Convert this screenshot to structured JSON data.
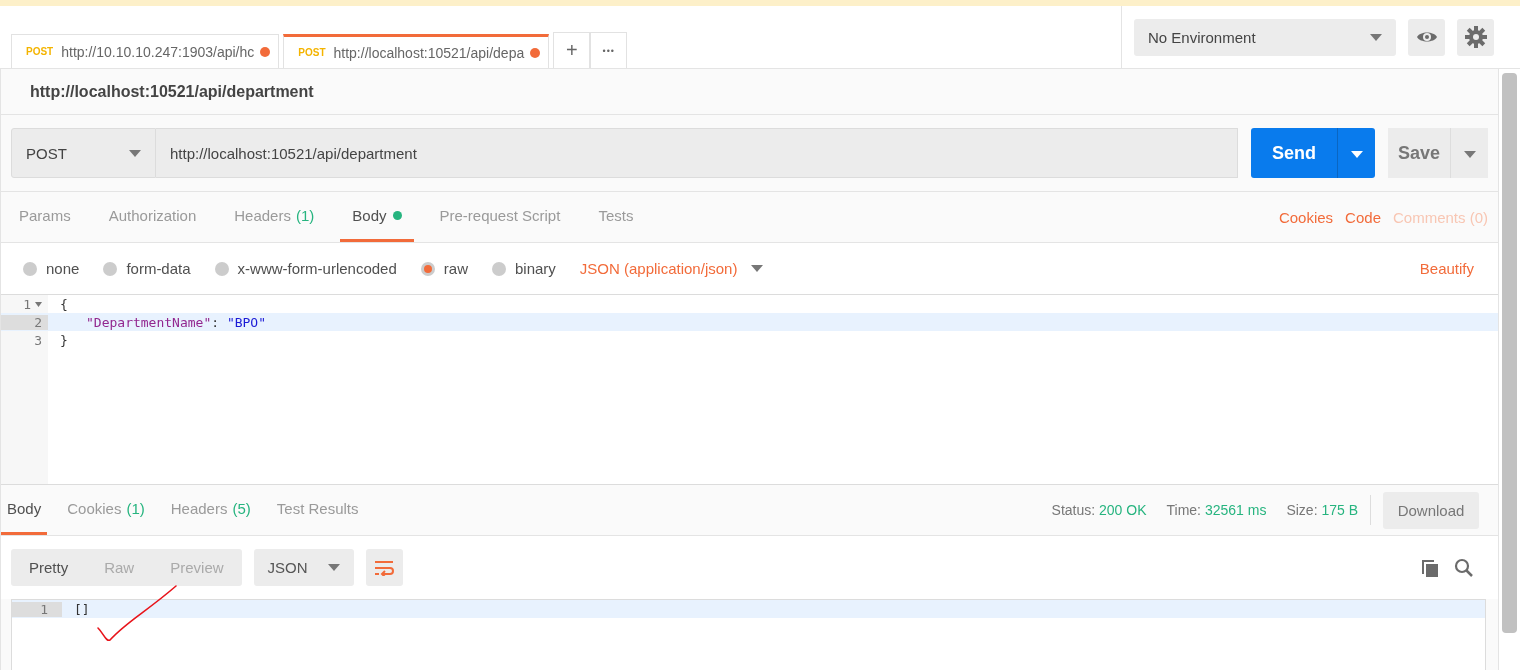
{
  "tabs": [
    {
      "method": "POST",
      "url": "http://10.10.10.247:1903/api/hc",
      "unsaved": true,
      "selected": false
    },
    {
      "method": "POST",
      "url": "http://localhost:10521/api/depa",
      "unsaved": true,
      "selected": true
    }
  ],
  "new_tab": "+",
  "more_tabs": "•••",
  "environment": {
    "label": "No Environment"
  },
  "request": {
    "title": "http://localhost:10521/api/department",
    "method": "POST",
    "url": "http://localhost:10521/api/department",
    "send": "Send",
    "save": "Save"
  },
  "request_tabs": [
    {
      "label": "Params",
      "selected": false,
      "has_data": false
    },
    {
      "label": "Authorization",
      "selected": false,
      "has_data": false
    },
    {
      "label": "Headers",
      "count": "(1)",
      "selected": false,
      "has_data": false
    },
    {
      "label": "Body",
      "selected": true,
      "has_data": true
    },
    {
      "label": "Pre-request Script",
      "selected": false,
      "has_data": false
    },
    {
      "label": "Tests",
      "selected": false,
      "has_data": false
    }
  ],
  "request_links": [
    {
      "label": "Cookies",
      "disabled": false
    },
    {
      "label": "Code",
      "disabled": false
    },
    {
      "label": "Comments (0)",
      "disabled": true
    }
  ],
  "body_modes": [
    {
      "label": "none",
      "selected": false
    },
    {
      "label": "form-data",
      "selected": false
    },
    {
      "label": "x-www-form-urlencoded",
      "selected": false
    },
    {
      "label": "raw",
      "selected": true
    },
    {
      "label": "binary",
      "selected": false
    }
  ],
  "body_format": "JSON (application/json)",
  "beautify": "Beautify",
  "request_lines": [
    {
      "number": "1",
      "foldable": true,
      "highlighted": false,
      "tokens": [
        {
          "kind": "punct",
          "text": "{"
        }
      ]
    },
    {
      "number": "2",
      "foldable": false,
      "highlighted": true,
      "tokens": [
        {
          "kind": "key",
          "text": "\"DepartmentName\""
        },
        {
          "kind": "punct",
          "text": ": "
        },
        {
          "kind": "string",
          "text": "\"BPO\""
        }
      ]
    },
    {
      "number": "3",
      "foldable": false,
      "highlighted": false,
      "tokens": [
        {
          "kind": "punct",
          "text": "}"
        }
      ]
    }
  ],
  "response": {
    "tabs": [
      {
        "label": "Body",
        "selected": true
      },
      {
        "label": "Cookies",
        "count": "(1)",
        "selected": false
      },
      {
        "label": "Headers",
        "count": "(5)",
        "selected": false
      },
      {
        "label": "Test Results",
        "selected": false
      }
    ],
    "stats": [
      {
        "label": "Status:",
        "value": "200 OK"
      },
      {
        "label": "Time:",
        "value": "32561 ms"
      },
      {
        "label": "Size:",
        "value": "175 B"
      }
    ],
    "download": "Download",
    "view_modes": [
      {
        "label": "Pretty",
        "selected": true
      },
      {
        "label": "Raw",
        "selected": false
      },
      {
        "label": "Preview",
        "selected": false
      }
    ],
    "format": "JSON",
    "wrap_on": true,
    "lines": [
      {
        "number": "1",
        "text": "[]",
        "highlighted": true
      }
    ]
  }
}
